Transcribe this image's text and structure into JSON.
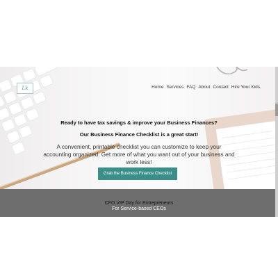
{
  "logo": {
    "text": "Lk",
    "color": "#5e9aa6"
  },
  "nav": {
    "items": [
      {
        "label": "Home"
      },
      {
        "label": "Services"
      },
      {
        "label": "FAQ"
      },
      {
        "label": "About"
      },
      {
        "label": "Contact"
      },
      {
        "label": "Hire Your Kids"
      }
    ]
  },
  "hero": {
    "headline": "Ready to have tax savings & improve your Business Finances?",
    "subheadline": "Our Business Finance Checklist is a great start!",
    "description": "A convenient, printable checklist you can customize to keep your accounting organized. Get more of what you want out of your business and work less!",
    "cta_label": "Grab the Business Finance Checklist",
    "cta_color": "#3b8f8a"
  },
  "vip": {
    "title": "CFO VIP Day for Entrepreneurs",
    "subtitle": "For Service-based CEOs"
  }
}
